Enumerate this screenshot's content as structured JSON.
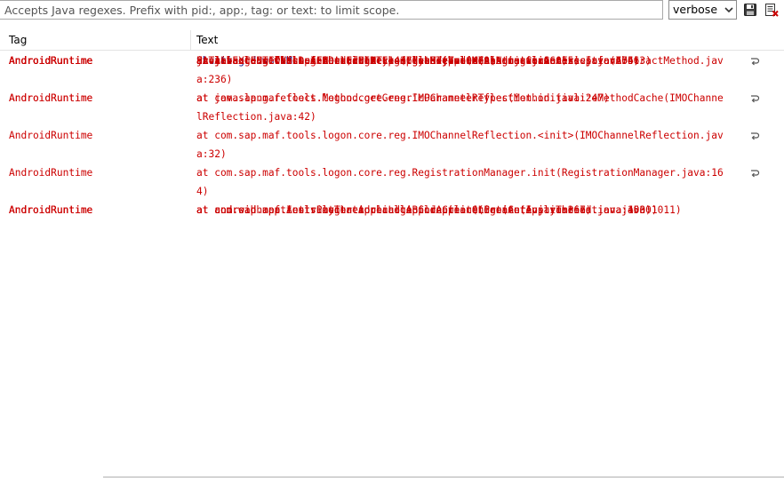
{
  "toolbar": {
    "filter_placeholder": "Accepts Java regexes. Prefix with pid:, app:, tag: or text: to limit scope.",
    "log_level": "verbose",
    "icons": [
      "save-icon",
      "clear-log-icon"
    ]
  },
  "columns": {
    "tag": "Tag",
    "text": "Text"
  },
  "colors": {
    "info": "#000080",
    "error": "#cc0000"
  },
  "rows": [
    {
      "level": "info",
      "tag": "AndroidRuntime",
      "text": [
        "Shutting down VM"
      ]
    },
    {
      "level": "error",
      "tag": "AndroidRuntime",
      "text": [
        "FATAL EXCEPTION: main"
      ]
    },
    {
      "level": "error",
      "tag": "AndroidRuntime",
      "text": [
        "Process: com.wahh.patient, PID: 14377"
      ]
    },
    {
      "level": "error",
      "tag": "AndroidRuntime",
      "text": [
        "java.lang.NoClassDefFoundError: com.sybase.mo.MessagingClientException"
      ]
    },
    {
      "level": "error",
      "tag": "AndroidRuntime",
      "text": [
        "at libcore.reflect.InternalNames.getClass(InternalNames.java:55)"
      ]
    },
    {
      "level": "error",
      "tag": "AndroidRuntime",
      "text": [
        "at java.lang.Class.getDexCacheType(Class.java:479)"
      ]
    },
    {
      "level": "error",
      "tag": "AndroidRuntime",
      "text": [
        "at libcore.reflect.AnnotationAccess.decodeValue(AnnotationAccess.java:705)"
      ]
    },
    {
      "level": "error",
      "tag": "AndroidRuntime",
      "text": [
        "at libcore.reflect.AnnotationAccess.decodeValue(AnnotationAccess.java:676)"
      ]
    },
    {
      "level": "error",
      "tag": "AndroidRuntime",
      "text": [
        "at libcore.reflect.AnnotationAccess.getExceptions(AnnotationAccess.java:463)"
      ]
    },
    {
      "level": "error",
      "tag": "AndroidRuntime",
      "text": [
        "at java.lang.reflect.Method.getExceptionTypes(Method.java:160)"
      ]
    },
    {
      "level": "error",
      "tag": "AndroidRuntime",
      "text": [
        "at java.lang.reflect.AbstractMethod.getMethodOrConstructorGenericInfo(AbstractMethod.jav",
        "a:236)"
      ]
    },
    {
      "level": "error",
      "tag": "AndroidRuntime",
      "text": [
        "at java.lang.reflect.Method.getGenericParameterTypes(Method.java:247)"
      ]
    },
    {
      "level": "error",
      "tag": "AndroidRuntime",
      "text": [
        "at com.sap.maf.tools.logon.core.reg.IMOChannelReflection.initializeMethodCache(IMOChanne",
        "lReflection.java:42)"
      ]
    },
    {
      "level": "error",
      "tag": "AndroidRuntime",
      "text": [
        "at com.sap.maf.tools.logon.core.reg.IMOChannelReflection.<init>(IMOChannelReflection.jav",
        "a:32)"
      ]
    },
    {
      "level": "error",
      "tag": "AndroidRuntime",
      "text": [
        "at com.sap.maf.tools.logon.core.reg.RegistrationManager.init(RegistrationManager.java:16",
        "4)"
      ]
    },
    {
      "level": "error",
      "tag": "AndroidRuntime",
      "text": [
        "at com.sap.maf.tools.logon.core.LogonCore.init(LogonCore.java:367)"
      ]
    },
    {
      "level": "error",
      "tag": "AndroidRuntime",
      "text": [
        "at com.wahh.patient.PatientApplication.onCreate(PatientApplication.java:100)"
      ]
    },
    {
      "level": "error",
      "tag": "AndroidRuntime",
      "text": [
        "at android.app.Instrumentation.callApplicationOnCreate(Instrumentation.java:1011)"
      ]
    },
    {
      "level": "error",
      "tag": "AndroidRuntime",
      "text": [
        "at android.app.ActivityThread.handleBindApplication(ActivityThread.java:4530)"
      ]
    }
  ]
}
